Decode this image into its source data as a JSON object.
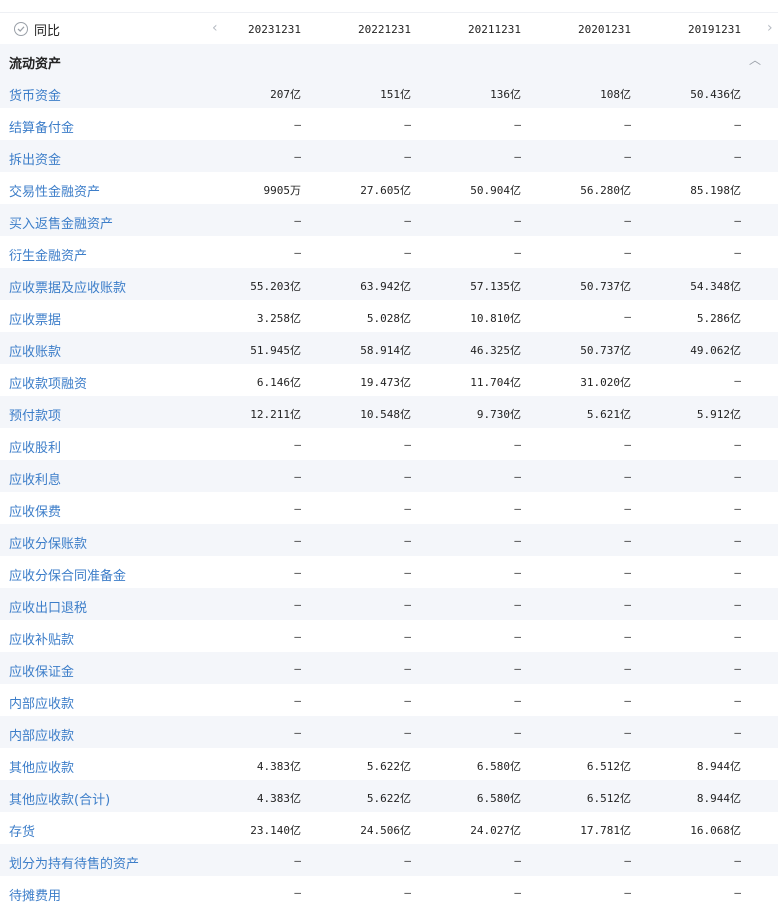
{
  "header": {
    "toggle_label": "同比",
    "prev_arrow": "‹",
    "next_arrow": "›",
    "dates": [
      "20231231",
      "20221231",
      "20211231",
      "20201231",
      "20191231"
    ]
  },
  "section": {
    "title": "流动资产",
    "collapse_icon": "︿"
  },
  "rows": [
    {
      "label": "货币资金",
      "values": [
        "207亿",
        "151亿",
        "136亿",
        "108亿",
        "50.436亿"
      ]
    },
    {
      "label": "结算备付金",
      "values": [
        "—",
        "—",
        "—",
        "—",
        "—"
      ]
    },
    {
      "label": "拆出资金",
      "values": [
        "—",
        "—",
        "—",
        "—",
        "—"
      ]
    },
    {
      "label": "交易性金融资产",
      "values": [
        "9905万",
        "27.605亿",
        "50.904亿",
        "56.280亿",
        "85.198亿"
      ]
    },
    {
      "label": "买入返售金融资产",
      "values": [
        "—",
        "—",
        "—",
        "—",
        "—"
      ]
    },
    {
      "label": "衍生金融资产",
      "values": [
        "—",
        "—",
        "—",
        "—",
        "—"
      ]
    },
    {
      "label": "应收票据及应收账款",
      "values": [
        "55.203亿",
        "63.942亿",
        "57.135亿",
        "50.737亿",
        "54.348亿"
      ]
    },
    {
      "label": "应收票据",
      "values": [
        "3.258亿",
        "5.028亿",
        "10.810亿",
        "—",
        "5.286亿"
      ]
    },
    {
      "label": "应收账款",
      "values": [
        "51.945亿",
        "58.914亿",
        "46.325亿",
        "50.737亿",
        "49.062亿"
      ]
    },
    {
      "label": "应收款项融资",
      "values": [
        "6.146亿",
        "19.473亿",
        "11.704亿",
        "31.020亿",
        "—"
      ]
    },
    {
      "label": "预付款项",
      "values": [
        "12.211亿",
        "10.548亿",
        "9.730亿",
        "5.621亿",
        "5.912亿"
      ]
    },
    {
      "label": "应收股利",
      "values": [
        "—",
        "—",
        "—",
        "—",
        "—"
      ]
    },
    {
      "label": "应收利息",
      "values": [
        "—",
        "—",
        "—",
        "—",
        "—"
      ]
    },
    {
      "label": "应收保费",
      "values": [
        "—",
        "—",
        "—",
        "—",
        "—"
      ]
    },
    {
      "label": "应收分保账款",
      "values": [
        "—",
        "—",
        "—",
        "—",
        "—"
      ]
    },
    {
      "label": "应收分保合同准备金",
      "values": [
        "—",
        "—",
        "—",
        "—",
        "—"
      ]
    },
    {
      "label": "应收出口退税",
      "values": [
        "—",
        "—",
        "—",
        "—",
        "—"
      ]
    },
    {
      "label": "应收补贴款",
      "values": [
        "—",
        "—",
        "—",
        "—",
        "—"
      ]
    },
    {
      "label": "应收保证金",
      "values": [
        "—",
        "—",
        "—",
        "—",
        "—"
      ]
    },
    {
      "label": "内部应收款",
      "values": [
        "—",
        "—",
        "—",
        "—",
        "—"
      ]
    },
    {
      "label": "内部应收款",
      "values": [
        "—",
        "—",
        "—",
        "—",
        "—"
      ]
    },
    {
      "label": "其他应收款",
      "values": [
        "4.383亿",
        "5.622亿",
        "6.580亿",
        "6.512亿",
        "8.944亿"
      ]
    },
    {
      "label": "其他应收款(合计)",
      "values": [
        "4.383亿",
        "5.622亿",
        "6.580亿",
        "6.512亿",
        "8.944亿"
      ]
    },
    {
      "label": "存货",
      "values": [
        "23.140亿",
        "24.506亿",
        "24.027亿",
        "17.781亿",
        "16.068亿"
      ]
    },
    {
      "label": "划分为持有待售的资产",
      "values": [
        "—",
        "—",
        "—",
        "—",
        "—"
      ]
    },
    {
      "label": "待摊费用",
      "values": [
        "—",
        "—",
        "—",
        "—",
        "—"
      ]
    }
  ]
}
